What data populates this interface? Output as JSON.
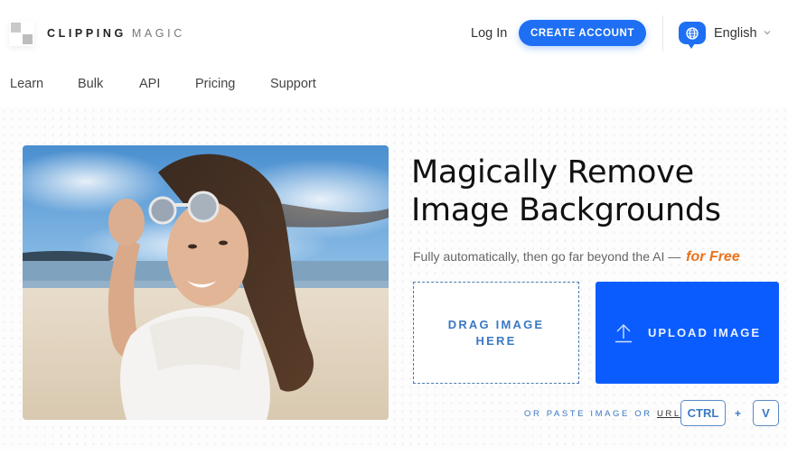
{
  "brand": {
    "name_bold": "CLIPPING",
    "name_light": "MAGIC"
  },
  "header": {
    "login_label": "Log In",
    "create_account_label": "CREATE ACCOUNT",
    "language": {
      "icon": "globe-icon",
      "selected": "English",
      "caret": "⌄"
    }
  },
  "nav": {
    "items": [
      {
        "label": "Learn"
      },
      {
        "label": "Bulk"
      },
      {
        "label": "API"
      },
      {
        "label": "Pricing"
      },
      {
        "label": "Support"
      }
    ]
  },
  "hero": {
    "image_alt": "Smiling woman on a beach holding sunglasses",
    "headline_line1": "Magically Remove",
    "headline_line2": "Image Backgrounds",
    "subtitle": "Fully automatically, then go far beyond the AI —",
    "subtitle_emphasis": "for Free",
    "drop_zone_line1": "DRAG IMAGE",
    "drop_zone_line2": "HERE",
    "upload_label": "UPLOAD IMAGE",
    "upload_icon": "upload-arrow-icon",
    "paste_text": "OR PASTE IMAGE OR",
    "paste_url_link": "URL",
    "shortcut_key1": "CTRL",
    "shortcut_plus": "+",
    "shortcut_key2": "V"
  },
  "colors": {
    "primary_blue": "#1e6ff3",
    "upload_blue": "#0a5cff",
    "accent_orange": "#e8731a",
    "link_blue": "#3a78c3"
  }
}
